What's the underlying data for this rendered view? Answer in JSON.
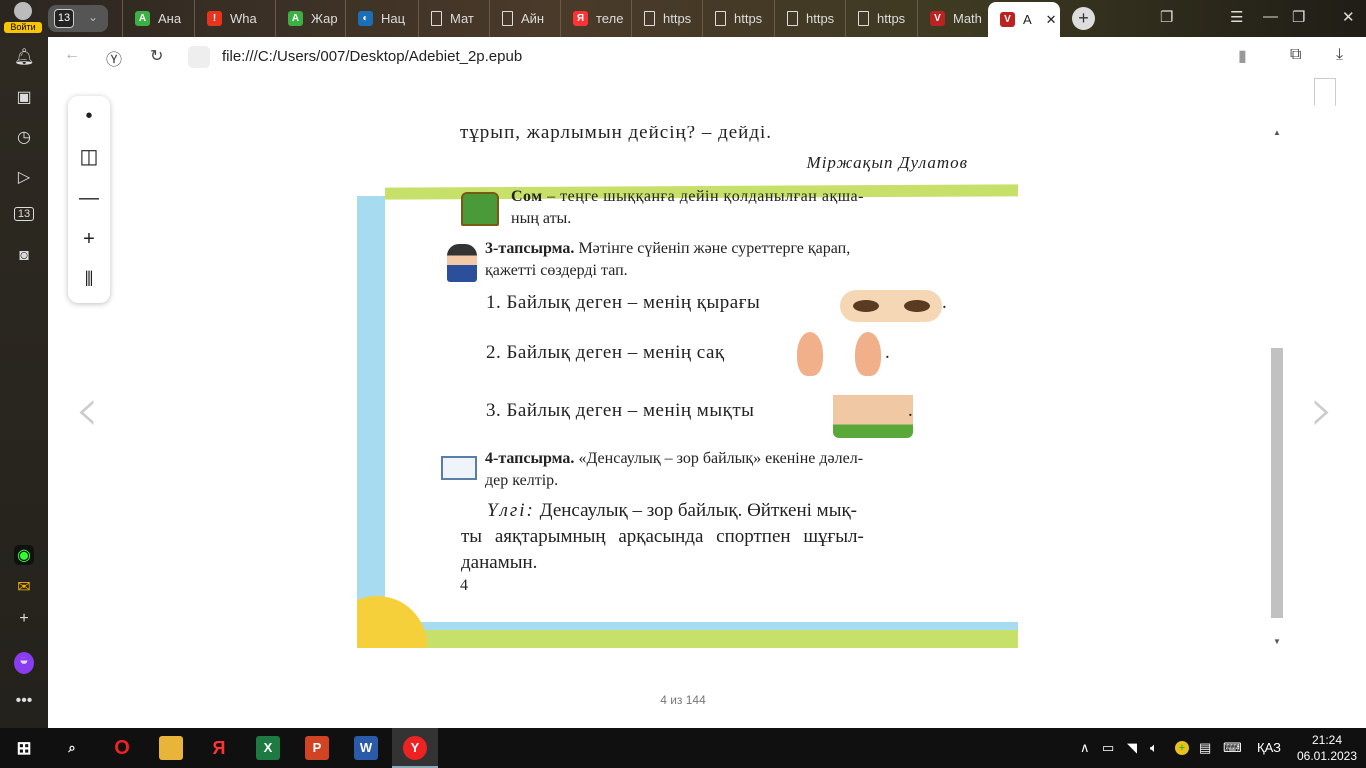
{
  "profile": {
    "login_label": "Войти"
  },
  "tab_count": "13",
  "tabs": [
    {
      "label": "Ана",
      "icon": "A",
      "color": "#3cb043"
    },
    {
      "label": "Wha",
      "icon": "!",
      "color": "#e8341c"
    },
    {
      "label": "Жар",
      "icon": "A",
      "color": "#3cb043"
    },
    {
      "label": "Нац",
      "icon": "globe",
      "color": "#1a6fb8"
    },
    {
      "label": "Мат",
      "icon": "doc",
      "color": ""
    },
    {
      "label": "Айн",
      "icon": "doc",
      "color": ""
    },
    {
      "label": "теле",
      "icon": "Я",
      "color": "#f33"
    },
    {
      "label": "https",
      "icon": "doc",
      "color": ""
    },
    {
      "label": "https",
      "icon": "doc",
      "color": ""
    },
    {
      "label": "https",
      "icon": "doc",
      "color": ""
    },
    {
      "label": "https",
      "icon": "doc",
      "color": ""
    },
    {
      "label": "Math",
      "icon": "V",
      "color": "#b22"
    },
    {
      "label": "A",
      "icon": "V",
      "color": "#b22",
      "active": true
    }
  ],
  "address": {
    "url": "file:///C:/Users/007/Desktop/Adebiet_2p.epub"
  },
  "book": {
    "line1": "тұрып, жарлымын дейсің? – дейді.",
    "author": "Міржақып Дулатов",
    "som_term": "Сом",
    "som_def1": " – теңге шыққанға дейін қолданылған ақша-",
    "som_def2": "ның аты.",
    "task3_label": "3-тапсырма.",
    "task3_text1": " Мәтінге сүйеніп және суреттерге қарап,",
    "task3_text2": "қажетті сөздерді тап.",
    "item1": "1. Байлық деген – менің қырағы",
    "item2": "2. Байлық деген – менің сақ",
    "item3": "3. Байлық деген – менің мықты",
    "dot": ".",
    "task4_label": "4-тапсырма.",
    "task4_text1": " «Денсаулық – зор байлық» екеніне дәлел-",
    "task4_text2": "дер келтір.",
    "example_label": "Үлгі:",
    "example1": " Денсаулық – зор байлық. Өйткені мық-",
    "example2": "ты аяқтарымның арқасында спортпен шұғыл-",
    "example3": "данамын.",
    "page_number": "4"
  },
  "pager": "4 из 144",
  "scroll_position_percent": 60,
  "tray": {
    "lang": "ҚАЗ",
    "time": "21:24",
    "date": "06.01.2023"
  }
}
